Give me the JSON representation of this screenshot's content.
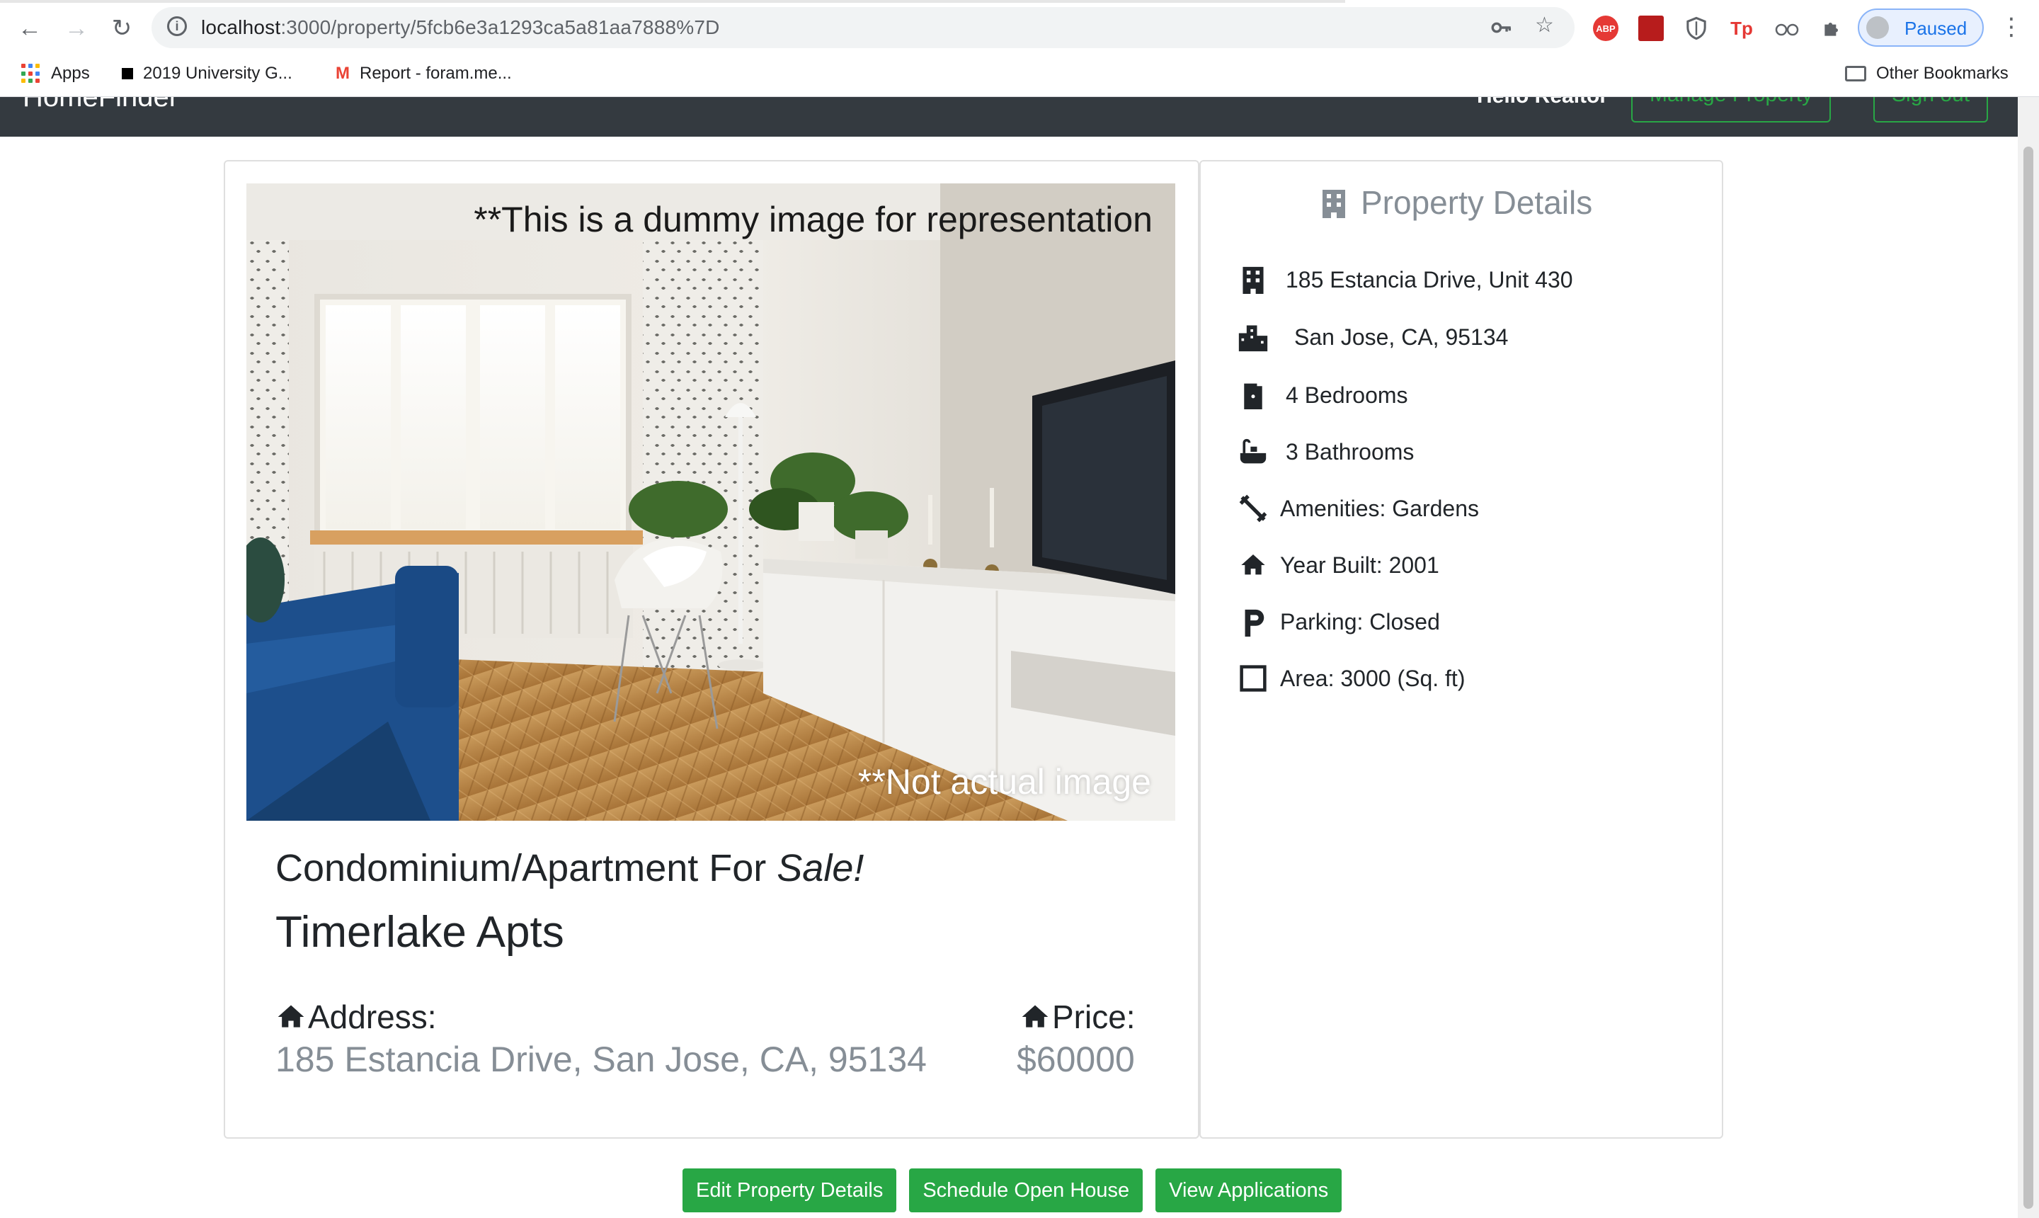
{
  "browser": {
    "url_host": "localhost",
    "url_path": ":3000/property/5fcb6e3a1293ca5a81aa7888%7D",
    "profile_label": "Paused",
    "bookmarks": [
      "Apps",
      "2019 University G...",
      "Report - foram.me..."
    ],
    "other_bookmarks": "Other Bookmarks",
    "extensions": [
      "ABP",
      "Tp"
    ]
  },
  "navbar": {
    "brand": "HomeFinder",
    "greeting": "Hello Realtor",
    "manage_button": "Manage Property",
    "signout_button": "Sign out"
  },
  "photo": {
    "caption_top": "**This is a dummy image for representation",
    "caption_bottom": "**Not actual image"
  },
  "listing": {
    "title_prefix": "Condominium/Apartment For ",
    "title_emphasis": "Sale!",
    "name": "Timerlake Apts",
    "address_label": "Address:",
    "address_value": "185 Estancia Drive, San Jose, CA, 95134",
    "price_label": "Price:",
    "price_value": "$60000"
  },
  "details": {
    "heading": "Property Details",
    "rows": [
      {
        "icon": "building-icon",
        "text": "185 Estancia Drive, Unit 430"
      },
      {
        "icon": "city-icon",
        "text": "San Jose, CA, 95134"
      },
      {
        "icon": "door-icon",
        "text": "4 Bedrooms"
      },
      {
        "icon": "bath-icon",
        "text": "3 Bathrooms"
      },
      {
        "icon": "dumbbell-icon",
        "text": "Amenities: Gardens"
      },
      {
        "icon": "home-icon",
        "text": "Year Built: 2001"
      },
      {
        "icon": "parking-icon",
        "text": "Parking: Closed"
      },
      {
        "icon": "square-icon",
        "text": "Area: 3000 (Sq. ft)"
      }
    ]
  },
  "actions": {
    "edit": "Edit Property Details",
    "schedule": "Schedule Open House",
    "applications": "View Applications"
  },
  "colors": {
    "accent_green": "#28a745",
    "navbar_dark": "#343a40",
    "muted_text": "#868e96"
  }
}
